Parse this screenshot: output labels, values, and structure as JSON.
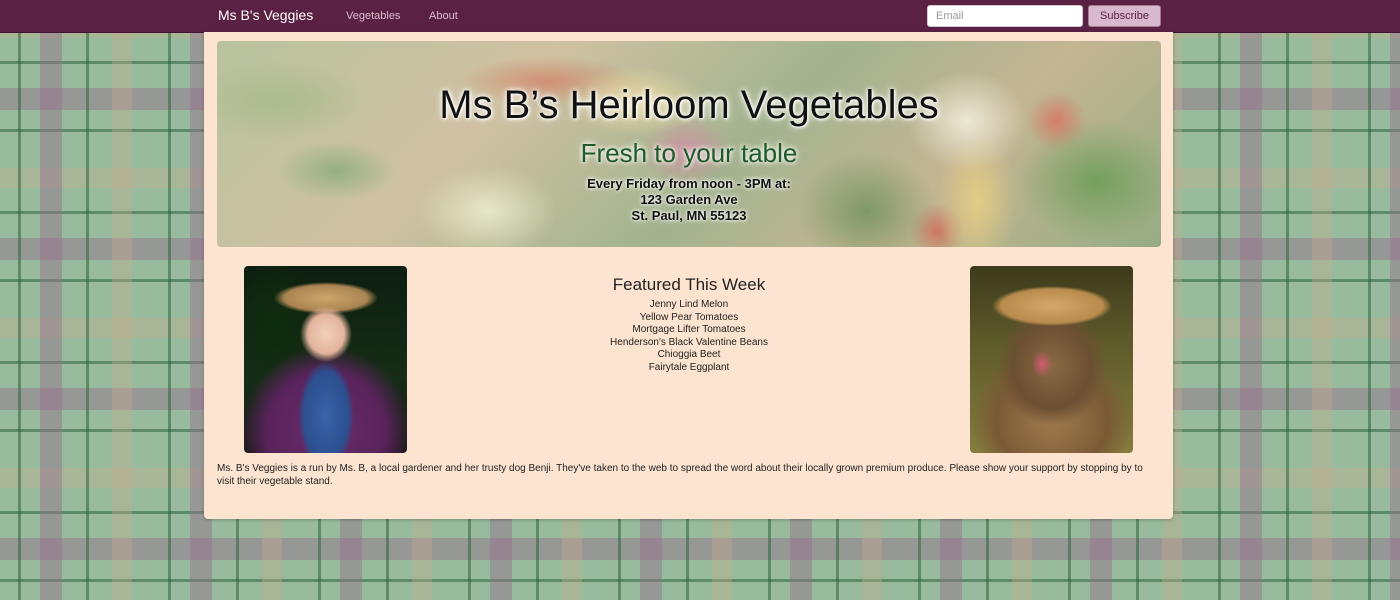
{
  "navbar": {
    "brand": "Ms B's Veggies",
    "links": [
      "Vegetables",
      "About"
    ],
    "email_placeholder": "Email",
    "subscribe_label": "Subscribe"
  },
  "hero": {
    "title": "Ms B’s Heirloom Vegetables",
    "subtitle": "Fresh to your table",
    "schedule": "Every Friday from noon - 3PM at:",
    "address_line1": "123 Garden Ave",
    "address_line2": "St. Paul, MN 55123"
  },
  "featured": {
    "title": "Featured This Week",
    "items": [
      "Jenny Lind Melon",
      "Yellow Pear Tomatoes",
      "Mortgage Lifter Tomatoes",
      "Henderson's Black Valentine Beans",
      "Chioggia Beet",
      "Fairytale Eggplant"
    ]
  },
  "about": {
    "text": "Ms. B's Veggies is a run by Ms. B, a local gardener and her trusty dog Benji. They've taken to the web to spread the word about their locally grown premium produce. Please show your support by stopping by to visit their vegetable stand."
  },
  "colors": {
    "navbar": "#5a2145",
    "container": "#fde4d0",
    "subtitle": "#1f5a2a",
    "subscribe_button": "#d7b8cc"
  }
}
